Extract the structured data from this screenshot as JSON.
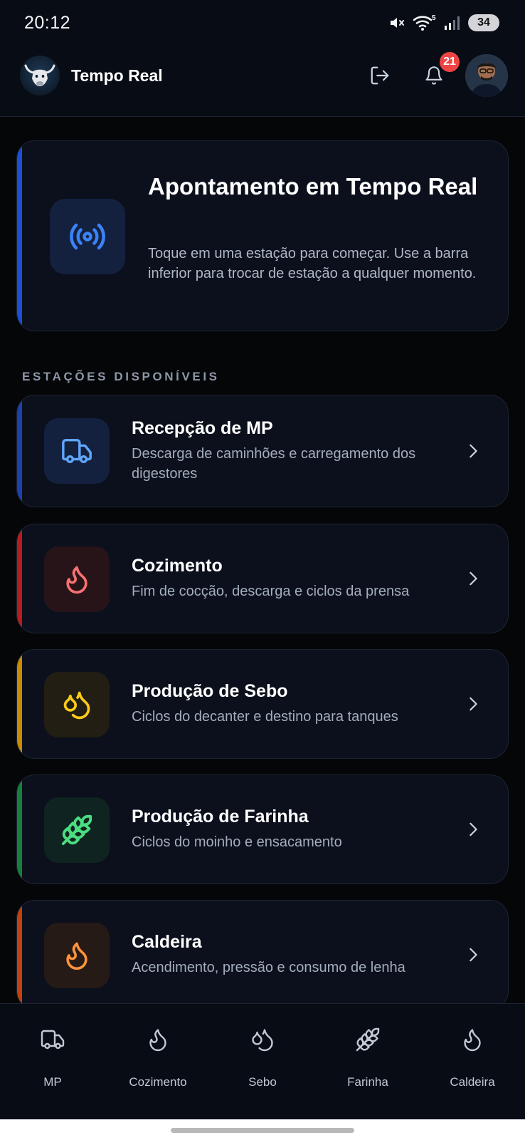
{
  "status_bar": {
    "time": "20:12",
    "icons": [
      "mute-icon",
      "wifi-icon",
      "signal-icon"
    ],
    "wifi_label": "5",
    "battery": "34"
  },
  "header": {
    "title": "Tempo Real",
    "logo_icon": "bull-logo-icon",
    "logout_icon": "logout-icon",
    "bell_icon": "bell-icon",
    "notification_count": "21"
  },
  "hero": {
    "title": "Apontamento em Tempo Real",
    "description": "Toque em uma estação para começar. Use a barra inferior para trocar de estação a qualquer momento.",
    "icon": "broadcast-icon",
    "accent_color": "#1d4ed8"
  },
  "section_label": "ESTAÇÕES DISPONÍVEIS",
  "stations": [
    {
      "title": "Recepção de MP",
      "description": "Descarga de caminhões e carregamento dos digestores",
      "icon": "truck-icon",
      "accent_color": "#1e40af",
      "icon_color": "#60a5fa",
      "icon_bg": "#13213f"
    },
    {
      "title": "Cozimento",
      "description": "Fim de cocção, descarga e ciclos da prensa",
      "icon": "flame-icon",
      "accent_color": "#b91c1c",
      "icon_color": "#f87171",
      "icon_bg": "#261419"
    },
    {
      "title": "Produção de Sebo",
      "description": "Ciclos do decanter e destino para tanques",
      "icon": "droplets-icon",
      "accent_color": "#ca8a04",
      "icon_color": "#facc15",
      "icon_bg": "#231e14"
    },
    {
      "title": "Produção de Farinha",
      "description": "Ciclos do moinho e ensacamento",
      "icon": "wheat-icon",
      "accent_color": "#15803d",
      "icon_color": "#4ade80",
      "icon_bg": "#0f2420"
    },
    {
      "title": "Caldeira",
      "description": "Acendimento, pressão e consumo de lenha",
      "icon": "flame-icon",
      "accent_color": "#c2410c",
      "icon_color": "#fb923c",
      "icon_bg": "#261a16"
    }
  ],
  "bottom_nav": [
    {
      "label": "MP",
      "icon": "truck-icon"
    },
    {
      "label": "Cozimento",
      "icon": "flame-icon"
    },
    {
      "label": "Sebo",
      "icon": "droplets-icon"
    },
    {
      "label": "Farinha",
      "icon": "wheat-icon"
    },
    {
      "label": "Caldeira",
      "icon": "flame-icon"
    }
  ]
}
